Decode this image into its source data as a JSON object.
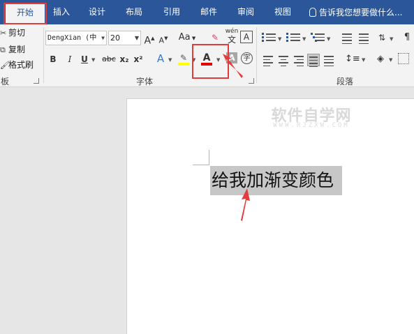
{
  "tabs": [
    "开始",
    "插入",
    "设计",
    "布局",
    "引用",
    "邮件",
    "审阅",
    "视图"
  ],
  "active_tab": "开始",
  "tell_me": "告诉我您想要做什么...",
  "clipboard": {
    "cut": "剪切",
    "copy": "复制",
    "format_painter": "格式刷",
    "group_label": "板"
  },
  "font": {
    "font_name": "DengXian (中",
    "font_size": "20",
    "grow": "A",
    "shrink": "A",
    "change_case": "Aa",
    "phonetic": "wén",
    "phonetic_char": "文",
    "char_border": "A",
    "bold": "B",
    "italic": "I",
    "underline": "U",
    "strikethrough": "abc",
    "subscript": "x₂",
    "superscript": "x²",
    "text_effects": "A",
    "font_color": "A",
    "char_shading": "A",
    "enclose": "字",
    "group_label": "字体"
  },
  "paragraph": {
    "group_label": "段落"
  },
  "colors": {
    "accent": "#2b579a",
    "font_color_bar": "#e00000",
    "highlight_bar": "#ffff00",
    "annotation": "#e23b3b"
  },
  "document": {
    "selected_text": "给我加渐变颜色",
    "watermark": "软件自学网",
    "watermark_sub": "WWW.RJZXW.COM"
  }
}
